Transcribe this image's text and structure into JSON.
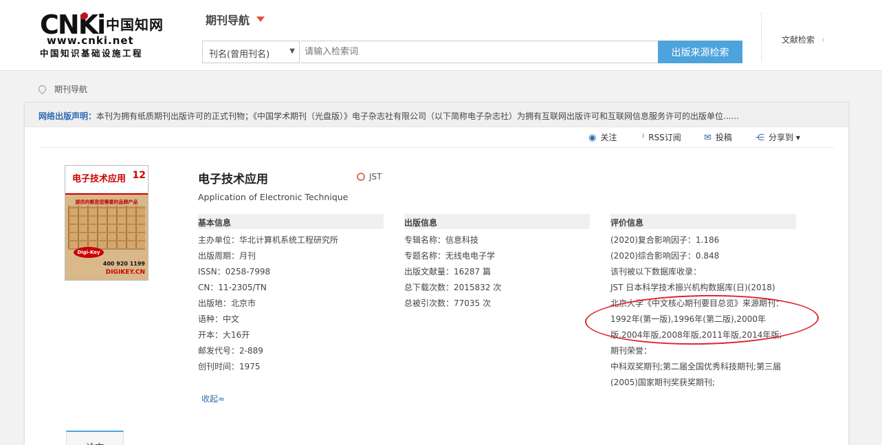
{
  "logo": {
    "brand": "CNKi",
    "cn_name": "中国知网",
    "url": "www.cnki.net",
    "slogan": "中国知识基础设施工程"
  },
  "header": {
    "nav_title": "期刊导航",
    "search_select": "刊名(曾用刊名)",
    "search_placeholder": "请输入检索词",
    "search_button": "出版来源检索",
    "doc_search": "文献检索"
  },
  "breadcrumb": "期刊导航",
  "notice": {
    "label": "网络出版声明：",
    "text": "本刊为拥有纸质期刊出版许可的正式刊物；《中国学术期刊（光盘版）》电子杂志社有限公司（以下简称电子杂志社）为拥有互联网出版许可和互联网信息服务许可的出版单位......"
  },
  "actions": {
    "follow": "关注",
    "rss": "RSS订阅",
    "submit": "投稿",
    "share": "分享到 ▾"
  },
  "cover": {
    "mag_title": "电子技术应用",
    "issue": "12",
    "slogan": "提供的都是您需要的品牌产品",
    "brand": "Digi-Key",
    "phone": "400 920 1199",
    "site": "DIGIKEY.CN"
  },
  "journal": {
    "title": "电子技术应用",
    "badge": "JST",
    "en_title": "Application of Electronic Technique"
  },
  "basic_info": {
    "heading": "基本信息",
    "lines": [
      "主办单位：华北计算机系统工程研究所",
      "出版周期：月刊",
      "ISSN：0258-7998",
      "CN：11-2305/TN",
      "出版地：北京市",
      "语种：中文",
      "开本：大16开",
      "邮发代号：2-889",
      "创刊时间：1975"
    ]
  },
  "publish_info": {
    "heading": "出版信息",
    "lines": [
      "专辑名称：信息科技",
      "专题名称：无线电电子学",
      "出版文献量：16287 篇",
      "总下载次数：2015832 次",
      "总被引次数：77035 次"
    ]
  },
  "eval_info": {
    "heading": "评价信息",
    "lines": [
      "(2020)复合影响因子：1.186",
      "(2020)综合影响因子：0.848",
      "该刊被以下数据库收录：",
      "JST 日本科学技术振兴机构数据库(日)(2018)",
      "北京大学《中文核心期刊要目总览》来源期刊：",
      "1992年(第一版),1996年(第二版),2000年版,2004年版,2008年版,2011年版,2014年版;",
      "期刊荣誉：",
      "中科双奖期刊;第二届全国优秀科技期刊;第三届(2005)国家期刊奖获奖期刊;"
    ]
  },
  "collapse": "收起≈",
  "tab": "论文",
  "colors": {
    "accent": "#4da3dc",
    "link": "#2c6bb0",
    "annotation": "#e0242a"
  }
}
